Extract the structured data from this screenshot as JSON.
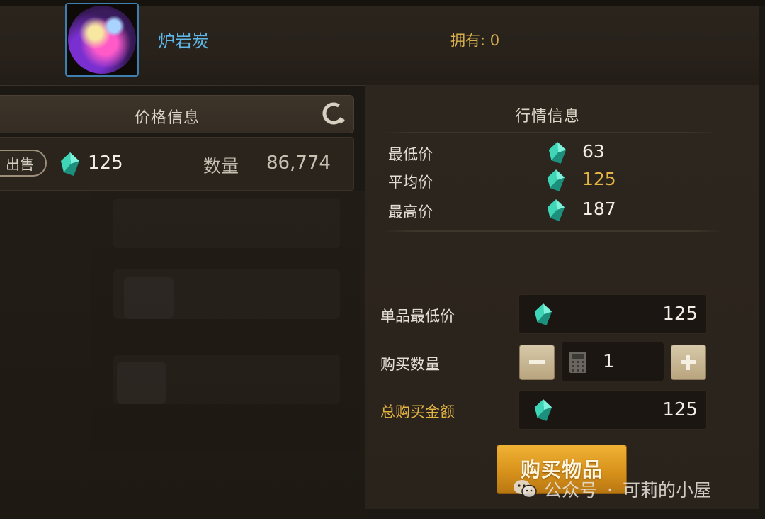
{
  "item": {
    "name": "炉岩炭",
    "owned_label": "拥有:",
    "owned_count": "0"
  },
  "price_panel": {
    "title": "价格信息",
    "listing": {
      "sell_label": "出售",
      "price": "125",
      "quantity_label": "数量",
      "quantity": "86,774"
    }
  },
  "market_panel": {
    "title": "行情信息",
    "stats": [
      {
        "label": "最低价",
        "value": "63"
      },
      {
        "label": "平均价",
        "value": "125"
      },
      {
        "label": "最高价",
        "value": "187"
      }
    ]
  },
  "purchase_form": {
    "unit_min_price_label": "单品最低价",
    "unit_min_price": "125",
    "quantity_label": "购买数量",
    "quantity": "1",
    "total_label": "总购买金额",
    "total": "125",
    "buy_button": "购买物品"
  },
  "watermark": {
    "channel": "公众号",
    "separator": "·",
    "name": "可莉的小屋"
  },
  "colors": {
    "gold_text": "#e5b544",
    "item_name": "#5fb7e8",
    "gem": "#3fd6b8",
    "buy_button": "#d7921b"
  },
  "icons": [
    "refresh-icon",
    "gem-icon",
    "calculator-icon",
    "minus-icon",
    "plus-icon",
    "wechat-icon"
  ]
}
